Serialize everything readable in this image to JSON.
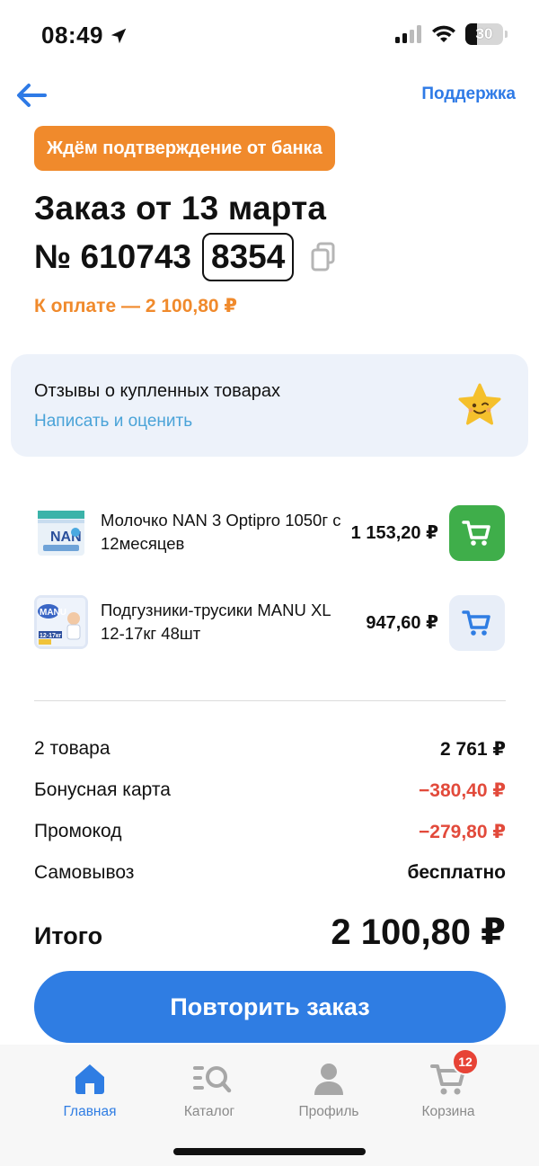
{
  "status_bar": {
    "time": "08:49",
    "battery": "30"
  },
  "header": {
    "support_label": "Поддержка"
  },
  "order": {
    "status": "Ждём подтверждение от банка",
    "title": "Заказ от 13 марта",
    "number_prefix": "№ 610743",
    "number_code": "8354",
    "to_pay": "К оплате — 2 100,80 ₽"
  },
  "reviews": {
    "title": "Отзывы о купленных товарах",
    "link": "Написать и оценить"
  },
  "products": [
    {
      "name": "Молочко NAN 3 Optipro 1050г с 12месяцев",
      "price": "1 153,20 ₽",
      "cart_style": "green"
    },
    {
      "name": "Подгузники-трусики MANU XL 12-17кг 48шт",
      "price": "947,60 ₽",
      "cart_style": "light"
    }
  ],
  "summary": {
    "items_label": "2 товара",
    "items_value": "2 761 ₽",
    "bonus_label": "Бонусная карта",
    "bonus_value": "−380,40 ₽",
    "promo_label": "Промокод",
    "promo_value": "−279,80 ₽",
    "delivery_label": "Самовывоз",
    "delivery_value": "бесплатно",
    "total_label": "Итого",
    "total_value": "2 100,80 ₽"
  },
  "repeat_button": "Повторить заказ",
  "tab_bar": {
    "home": "Главная",
    "catalog": "Каталог",
    "profile": "Профиль",
    "cart": "Корзина",
    "cart_badge": "12"
  },
  "colors": {
    "accent": "#2f7de3",
    "orange": "#f08a2c",
    "green": "#3fae4a",
    "red": "#e24a3b"
  }
}
